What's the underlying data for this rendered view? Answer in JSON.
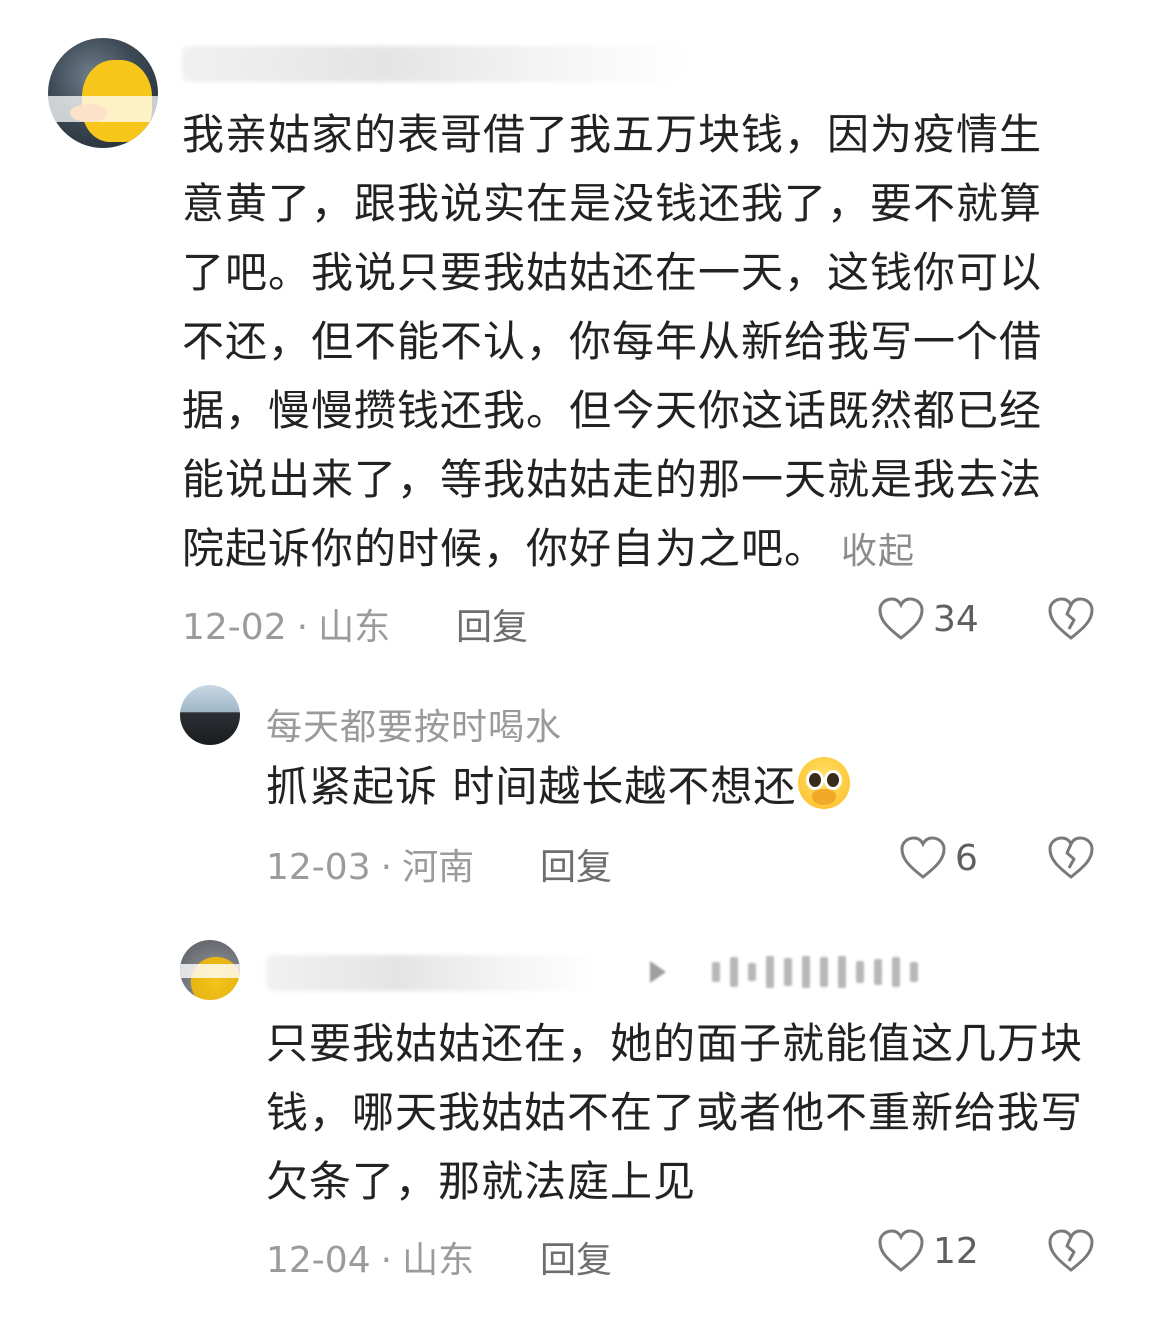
{
  "comments": [
    {
      "text": "我亲姑家的表哥借了我五万块钱，因为疫情生意黄了，跟我说实在是没钱还我了，要不就算了吧。我说只要我姑姑还在一天，这钱你可以不还，但不能不认，你每年从新给我写一个借据，慢慢攒钱还我。但今天你这话既然都已经能说出来了，等我姑姑走的那一天就是我去法院起诉你的时候，你好自为之吧。",
      "collapse_label": "收起",
      "date": "12-02",
      "location": "山东",
      "reply_label": "回复",
      "likes": "34"
    },
    {
      "username": "每天都要按时喝水",
      "text": "抓紧起诉 时间越长越不想还",
      "emoji": "pleading-face-emoji",
      "date": "12-03",
      "location": "河南",
      "reply_label": "回复",
      "likes": "6"
    },
    {
      "text": "只要我姑姑还在，她的面子就能值这几万块钱，哪天我姑姑不在了或者他不重新给我写欠条了，那就法庭上见",
      "date": "12-04",
      "location": "山东",
      "reply_label": "回复",
      "likes": "12"
    }
  ],
  "separator": "·",
  "icons": {
    "like": "heart-outline-icon",
    "dislike": "broken-heart-icon",
    "play": "play-icon"
  },
  "colors": {
    "text": "#222222",
    "meta": "#9b9b9b",
    "icon": "#7a7a7a"
  }
}
